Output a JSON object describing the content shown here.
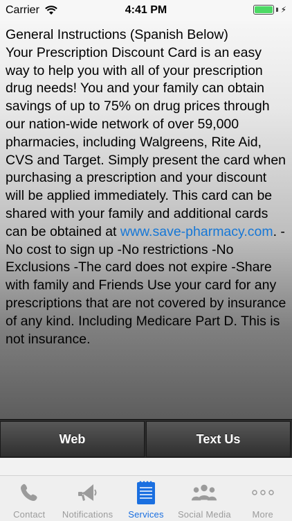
{
  "status_bar": {
    "carrier": "Carrier",
    "time": "4:41 PM",
    "battery_level": 1.0
  },
  "content": {
    "intro_line": "General Instructions (Spanish Below)",
    "paragraph_before_link": "Your Prescription Discount Card is an easy way to help you with all of your prescription drug needs! You and your family can obtain savings of up to 75% on drug prices through our nation-wide network of over 59,000 pharmacies, including Walgreens, Rite Aid, CVS and Target. Simply present the card when purchasing a prescription and your discount will be applied immediately. This card can be shared with your family and additional cards can be obtained at ",
    "link_text": "www.save-pharmacy.com",
    "paragraph_after_link": ". -No cost to sign up -No restrictions -No Exclusions -The card does not expire -Share with family and Friends Use your card for any prescriptions that are not covered by insurance of any kind. Including Medicare Part D. This is not insurance."
  },
  "action_bar": {
    "web_label": "Web",
    "text_label": "Text Us"
  },
  "tabs": [
    {
      "label": "Contact",
      "icon": "phone-icon",
      "active": false
    },
    {
      "label": "Notifications",
      "icon": "megaphone-icon",
      "active": false
    },
    {
      "label": "Services",
      "icon": "list-document-icon",
      "active": true
    },
    {
      "label": "Social Media",
      "icon": "people-icon",
      "active": false
    },
    {
      "label": "More",
      "icon": "ellipsis-icon",
      "active": false
    }
  ],
  "colors": {
    "active_tab": "#1a6fe0",
    "inactive_tab": "#9b9b9b",
    "link": "#1677d6",
    "battery": "#4cd964"
  }
}
